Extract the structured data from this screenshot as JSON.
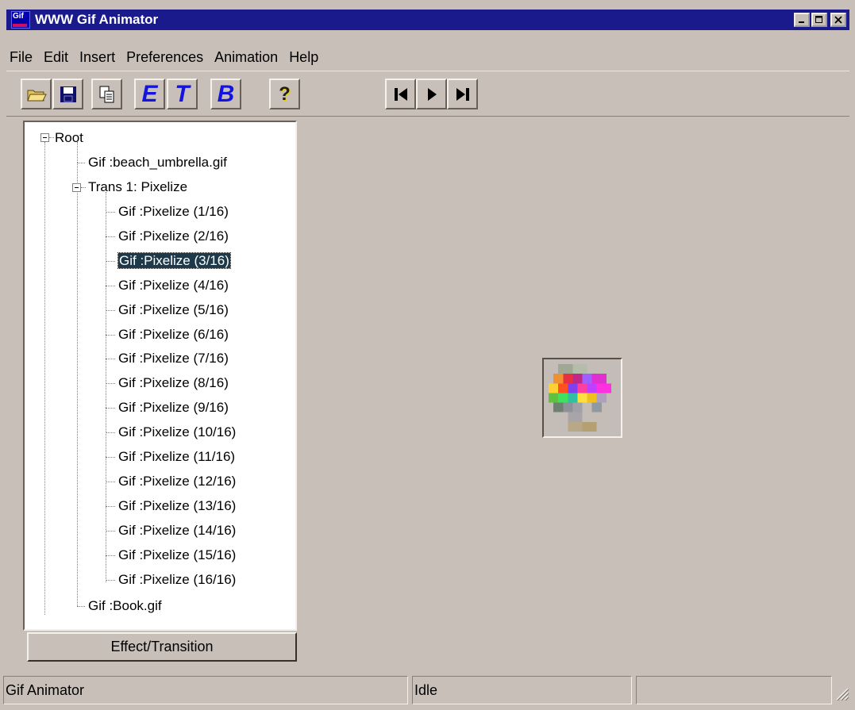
{
  "window": {
    "title": "WWW Gif Animator",
    "app_icon_text": "Gif",
    "controls": [
      "minimize-icon",
      "maximize-icon",
      "close-icon"
    ]
  },
  "menu": {
    "items": [
      {
        "label": "File"
      },
      {
        "label": "Edit"
      },
      {
        "label": "Insert"
      },
      {
        "label": "Preferences"
      },
      {
        "label": "Animation"
      },
      {
        "label": "Help"
      }
    ]
  },
  "toolbar": {
    "buttons": [
      {
        "name": "open-icon"
      },
      {
        "name": "save-icon"
      },
      {
        "name": "copy-icon"
      },
      {
        "name": "effect-icon",
        "letter": "E"
      },
      {
        "name": "transition-icon",
        "letter": "T"
      },
      {
        "name": "bold-icon",
        "letter": "B"
      },
      {
        "name": "help-icon",
        "letter": "?"
      },
      {
        "name": "first-frame-icon"
      },
      {
        "name": "play-icon"
      },
      {
        "name": "last-frame-icon"
      }
    ]
  },
  "tree": {
    "root": "Root",
    "gif1": "Gif :beach_umbrella.gif",
    "trans": "Trans 1: Pixelize",
    "frames": [
      "Gif :Pixelize (1/16)",
      "Gif :Pixelize (2/16)",
      "Gif :Pixelize (3/16)",
      "Gif :Pixelize (4/16)",
      "Gif :Pixelize (5/16)",
      "Gif :Pixelize (6/16)",
      "Gif :Pixelize (7/16)",
      "Gif :Pixelize (8/16)",
      "Gif :Pixelize (9/16)",
      "Gif :Pixelize (10/16)",
      "Gif :Pixelize (11/16)",
      "Gif :Pixelize (12/16)",
      "Gif :Pixelize (13/16)",
      "Gif :Pixelize (14/16)",
      "Gif :Pixelize (15/16)",
      "Gif :Pixelize (16/16)"
    ],
    "selected_index": 2,
    "gif2": "Gif :Book.gif"
  },
  "effect_button": "Effect/Transition",
  "status": {
    "left": "Gif Animator",
    "middle": "Idle",
    "right": ""
  },
  "colors": {
    "titlebar": "#1a1a8c",
    "face": "#c8c0b8",
    "selection": "#1e3a4a"
  }
}
